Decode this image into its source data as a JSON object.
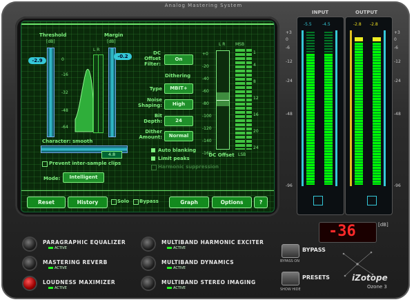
{
  "app_title": "Analog Mastering System",
  "limiter": {
    "threshold_label": "Threshold",
    "threshold_unit": "[dB]",
    "threshold_value": "-2.9",
    "margin_label": "Margin",
    "margin_unit": "[dB]",
    "margin_value": "-0.2",
    "gain_scale": [
      "0",
      "-16",
      "-32",
      "-48",
      "-64"
    ],
    "lr_top": "L  R",
    "character_label": "Character: smooth",
    "character_value": "4.8",
    "prevent_clips_label": "Prevent inter-sample clips",
    "mode_label": "Mode:",
    "mode_value": "Intelligent"
  },
  "dither": {
    "dc_offset_label": "DC Offset Filter:",
    "dc_offset_value": "On",
    "dithering_label": "Dithering",
    "type_label": "Type",
    "type_value": "MBIT+",
    "noise_label": "Noise Shaping:",
    "noise_value": "High",
    "bit_label": "Bit Depth:",
    "bit_value": "24",
    "amount_label": "Dither Amount:",
    "amount_value": "Normal",
    "auto_blanking": "Auto blanking",
    "limit_peaks": "Limit peaks",
    "harmonic_suppression": "Harmonic suppression"
  },
  "dc_meter": {
    "lr_label": "L  R",
    "msb_label": "MSB",
    "lsb_label": "LSB",
    "scale": [
      "+0",
      "-20",
      "-40",
      "-60",
      "-80",
      "-100",
      "-120",
      "-140",
      "-160"
    ],
    "bits": [
      "1",
      "4",
      "8",
      "12",
      "16",
      "20",
      "24"
    ],
    "caption": "DC Offset"
  },
  "bottom_bar": {
    "reset": "Reset",
    "history": "History",
    "solo": "Solo",
    "bypass": "Bypass",
    "graph": "Graph",
    "options": "Options",
    "help": "?"
  },
  "meters": {
    "input_label": "INPUT",
    "output_label": "OUTPUT",
    "input_peaks": [
      "-5.5",
      "-4.5"
    ],
    "output_peaks": [
      "-2.8",
      "-2.8"
    ],
    "scale": [
      "+3",
      "0",
      "-6",
      "-12",
      "-24",
      "-48",
      "-96"
    ],
    "scale_right": [
      "+3",
      "0",
      "-6",
      "-12",
      "-24",
      "-48",
      "-96"
    ]
  },
  "readout": {
    "value": "-36",
    "unit": "[dB]"
  },
  "modules": [
    {
      "name": "PARAGRAPHIC EQUALIZER",
      "status": "ACTIVE"
    },
    {
      "name": "MASTERING REVERB",
      "status": "ACTIVE"
    },
    {
      "name": "LOUDNESS MAXIMIZER",
      "status": "ACTIVE"
    },
    {
      "name": "MULTIBAND HARMONIC EXCITER",
      "status": "ACTIVE"
    },
    {
      "name": "MULTIBAND DYNAMICS",
      "status": "ACTIVE"
    },
    {
      "name": "MULTIBAND STEREO IMAGING",
      "status": "ACTIVE"
    }
  ],
  "side": {
    "bypass": "BYPASS",
    "bypass_sub": "BYPASS  ON",
    "presets": "PRESETS",
    "presets_sub": "SHOW  HIDE",
    "logo": "iZotope",
    "logo_sub": "Ozone 3"
  },
  "colors": {
    "lcd_green": "#7ef07e",
    "led_red": "#ff2a2a",
    "accent_cyan": "#35c8d8"
  }
}
